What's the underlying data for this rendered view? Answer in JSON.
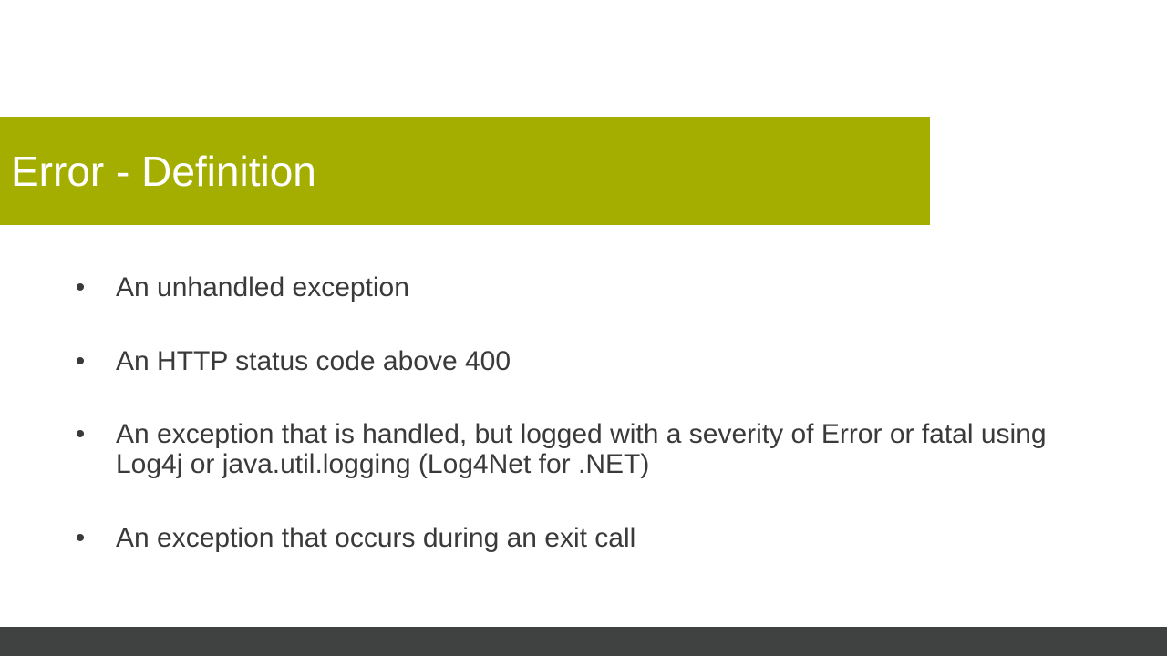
{
  "slide": {
    "title": "Error - Definition",
    "bullet_glyph": "•",
    "bullets": [
      "An unhandled exception",
      "An HTTP status code above 400",
      "An exception that is handled, but logged with a severity of Error or fatal using Log4j or java.util.logging (Log4Net for .NET)",
      "An exception that occurs during an exit call"
    ]
  },
  "colors": {
    "title_band": "#a4ae00",
    "title_text": "#ffffff",
    "body_text": "#3a3a3a",
    "footer_bar": "#404241",
    "background": "#ffffff"
  }
}
